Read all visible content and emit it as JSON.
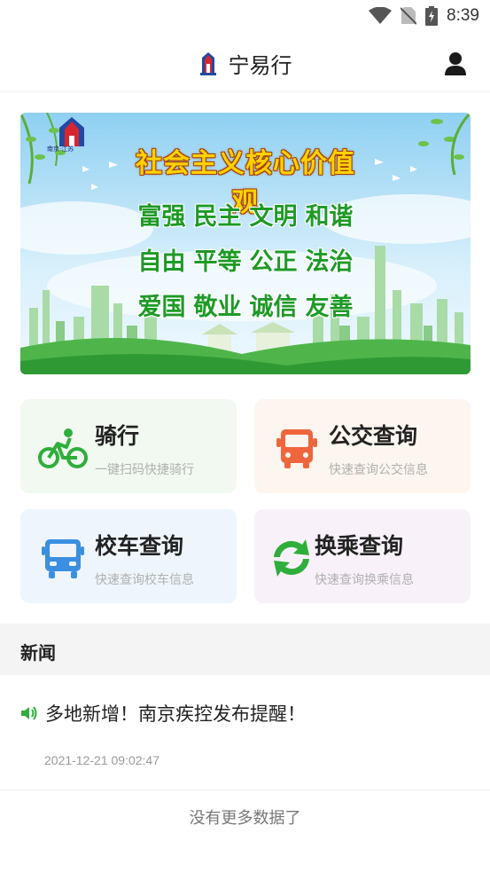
{
  "status_bar": {
    "time": "8:39",
    "icons": [
      "wifi-icon",
      "no-sim-icon",
      "battery-charging-icon"
    ]
  },
  "header": {
    "title": "宁易行",
    "logo": "nanjing-logo",
    "profile_icon": "user-icon"
  },
  "banner": {
    "heading": "社会主义核心价值观",
    "words": [
      "富强",
      "民主",
      "文明",
      "和谐",
      "自由",
      "平等",
      "公正",
      "法治",
      "爱国",
      "敬业",
      "诚信",
      "友善"
    ],
    "logo_text": "南京·江苏"
  },
  "cards": [
    {
      "title": "骑行",
      "subtitle": "一键扫码快捷骑行",
      "icon": "bicycle-icon",
      "bg": "#f1f9f0",
      "icon_color": "#2fae3c"
    },
    {
      "title": "公交查询",
      "subtitle": "快速查询公交信息",
      "icon": "bus-icon",
      "bg": "#fdf5ef",
      "icon_color": "#f0663c"
    },
    {
      "title": "校车查询",
      "subtitle": "快速查询校车信息",
      "icon": "school-bus-icon",
      "bg": "#eef5fd",
      "icon_color": "#3a8fe0"
    },
    {
      "title": "换乘查询",
      "subtitle": "快速查询换乘信息",
      "icon": "transfer-icon",
      "bg": "#f8f1fa",
      "icon_color": "#2fae3c"
    }
  ],
  "news": {
    "section_title": "新闻",
    "items": [
      {
        "title": "多地新增！南京疾控发布提醒！",
        "time": "2021-12-21 09:02:47",
        "icon": "speaker-icon"
      }
    ],
    "end_text": "没有更多数据了"
  }
}
